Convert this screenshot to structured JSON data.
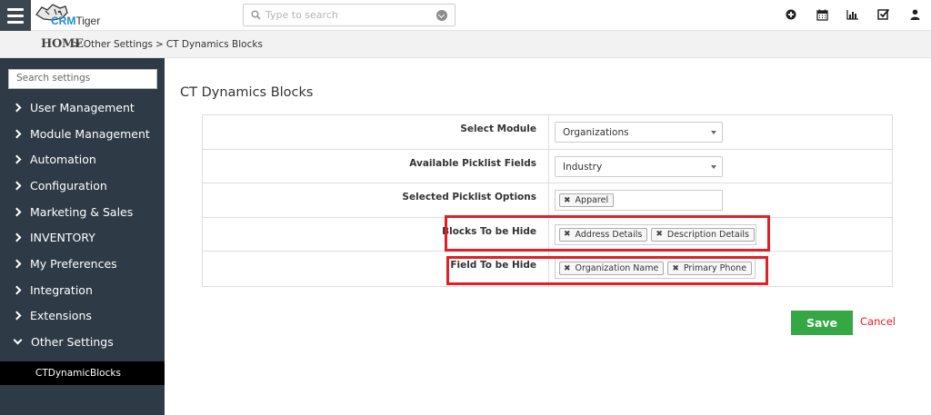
{
  "header": {
    "logo_text_crm": "CRM",
    "logo_text_tiger": "Tiger",
    "search_placeholder": "Type to search",
    "icons": [
      "plus-circle-icon",
      "calendar-icon",
      "bar-chart-icon",
      "checkbox-icon",
      "user-icon"
    ]
  },
  "breadcrumb": {
    "home": "HOME",
    "items": [
      "Other Settings",
      "CT Dynamics Blocks"
    ]
  },
  "sidebar": {
    "search_placeholder": "Search settings",
    "items": [
      {
        "label": "User Management"
      },
      {
        "label": "Module Management"
      },
      {
        "label": "Automation"
      },
      {
        "label": "Configuration"
      },
      {
        "label": "Marketing & Sales"
      },
      {
        "label": "INVENTORY"
      },
      {
        "label": "My Preferences"
      },
      {
        "label": "Integration"
      },
      {
        "label": "Extensions"
      },
      {
        "label": "Other Settings"
      }
    ],
    "active_sub_item": "CTDynamicBlocks"
  },
  "main": {
    "title": "CT Dynamics Blocks",
    "form": {
      "select_module_label": "Select Module",
      "select_module_value": "Organizations",
      "picklist_fields_label": "Available Picklist Fields",
      "picklist_fields_value": "Industry",
      "picklist_options_label": "Selected Picklist Options",
      "picklist_options_tags": [
        "Apparel"
      ],
      "blocks_hide_label": "Blocks To be Hide",
      "blocks_hide_tags": [
        "Address Details",
        "Description Details"
      ],
      "field_hide_label": "Field To be Hide",
      "field_hide_tags": [
        "Organization Name",
        "Primary Phone"
      ]
    },
    "save_label": "Save",
    "cancel_label": "Cancel"
  },
  "colors": {
    "sidebar_bg": "#2e3b46",
    "save_green": "#35a744",
    "highlight_red": "#e01f26",
    "logo_blue": "#1a8ccf"
  }
}
